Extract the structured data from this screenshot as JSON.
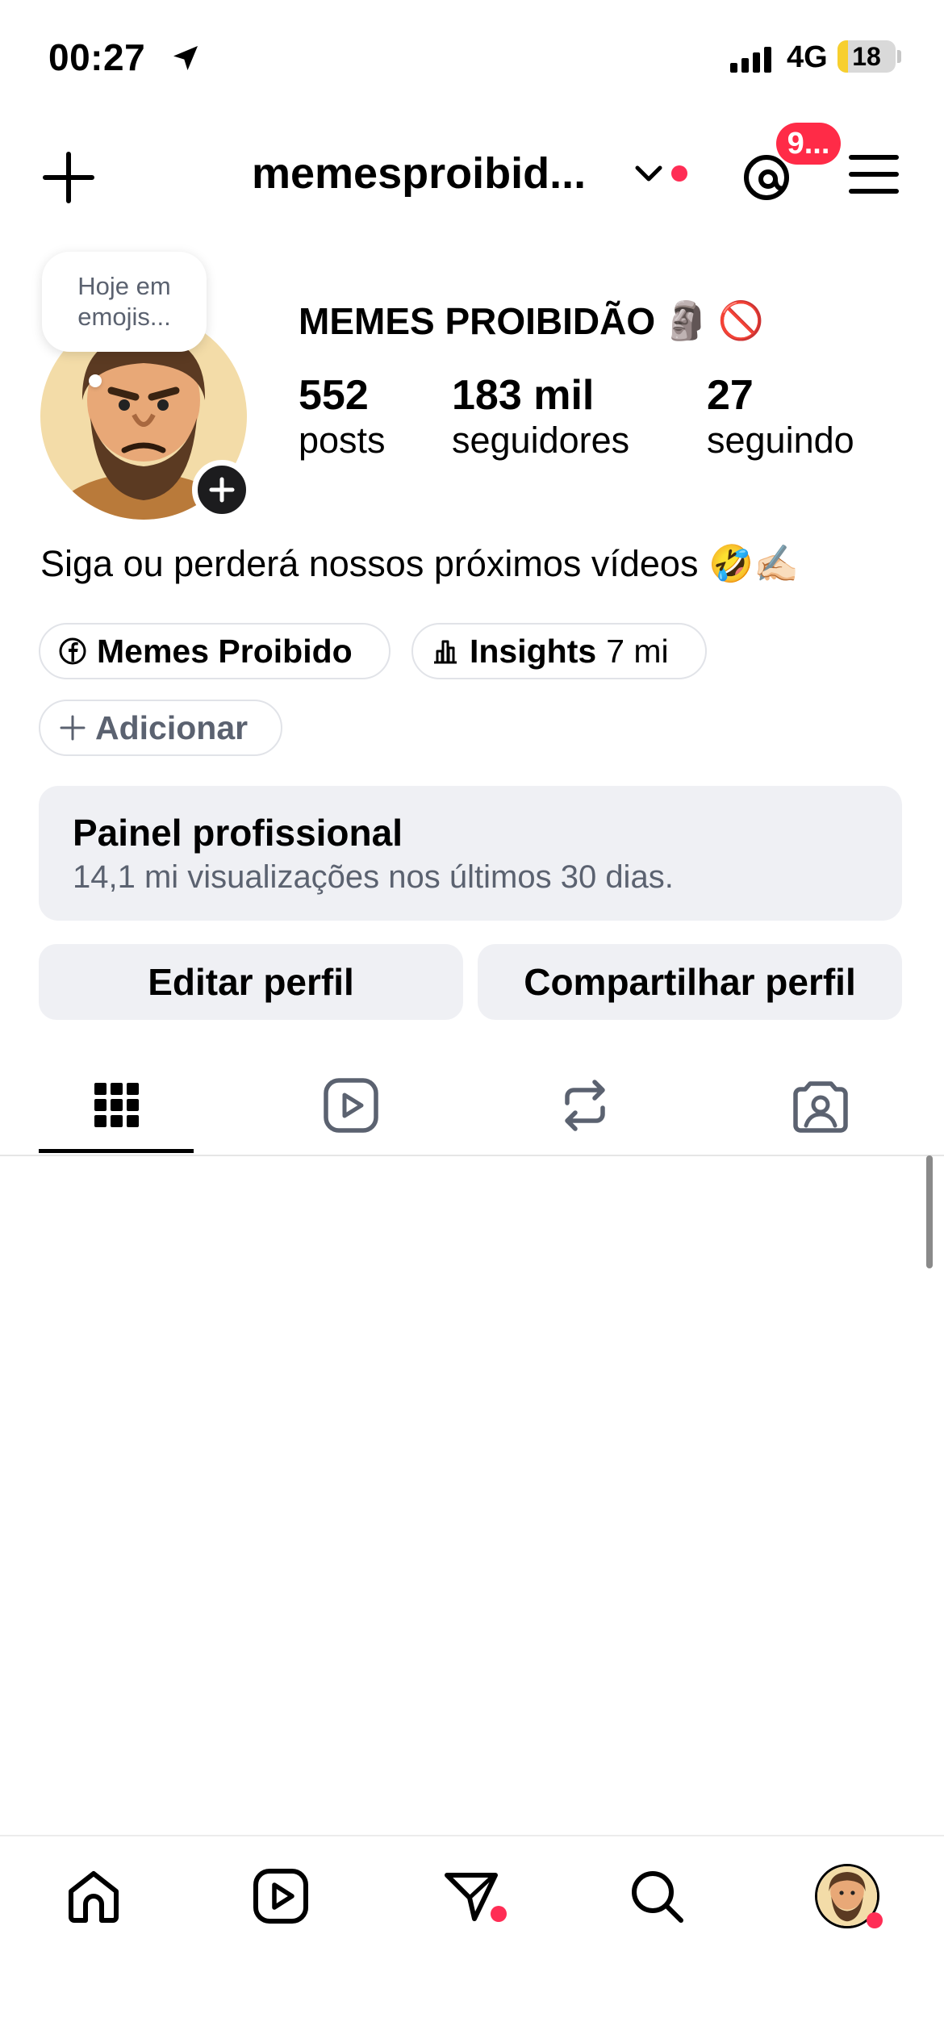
{
  "status_bar": {
    "time": "00:27",
    "network": "4G",
    "battery": "18",
    "battery_level": 0.18
  },
  "header": {
    "username": "memesproibid...",
    "notification_count": "9..."
  },
  "profile": {
    "note": "Hoje em emojis...",
    "display_name": "MEMES PROIBIDÃO",
    "display_emojis": [
      "🗿",
      "🚫"
    ],
    "stats": [
      {
        "value": "552",
        "label": "posts"
      },
      {
        "value": "183 mil",
        "label": "seguidores"
      },
      {
        "value": "27",
        "label": "seguindo"
      }
    ],
    "bio": "Siga ou perderá nossos próximos vídeos 🤣✍🏻"
  },
  "pills": {
    "facebook_label": "Memes Proibido",
    "insights_label": "Insights",
    "insights_value": "7 mi",
    "add_label": "Adicionar"
  },
  "pro_panel": {
    "title": "Painel profissional",
    "subtitle": "14,1 mi visualizações nos últimos 30 dias."
  },
  "actions": {
    "edit": "Editar perfil",
    "share": "Compartilhar perfil"
  },
  "tabs": [
    {
      "icon": "grid-icon",
      "active": true
    },
    {
      "icon": "reels-icon",
      "active": false
    },
    {
      "icon": "repost-icon",
      "active": false
    },
    {
      "icon": "tagged-icon",
      "active": false
    }
  ],
  "bottom_nav": [
    {
      "icon": "home-icon"
    },
    {
      "icon": "reels-icon"
    },
    {
      "icon": "direct-icon",
      "dot": true
    },
    {
      "icon": "search-icon"
    },
    {
      "icon": "profile-avatar",
      "dot": true
    }
  ],
  "colors": {
    "accent_red": "#ff2b47",
    "panel_bg": "#eff0f4",
    "muted_text": "#5b6270",
    "battery_fill": "#f7cf2e"
  }
}
